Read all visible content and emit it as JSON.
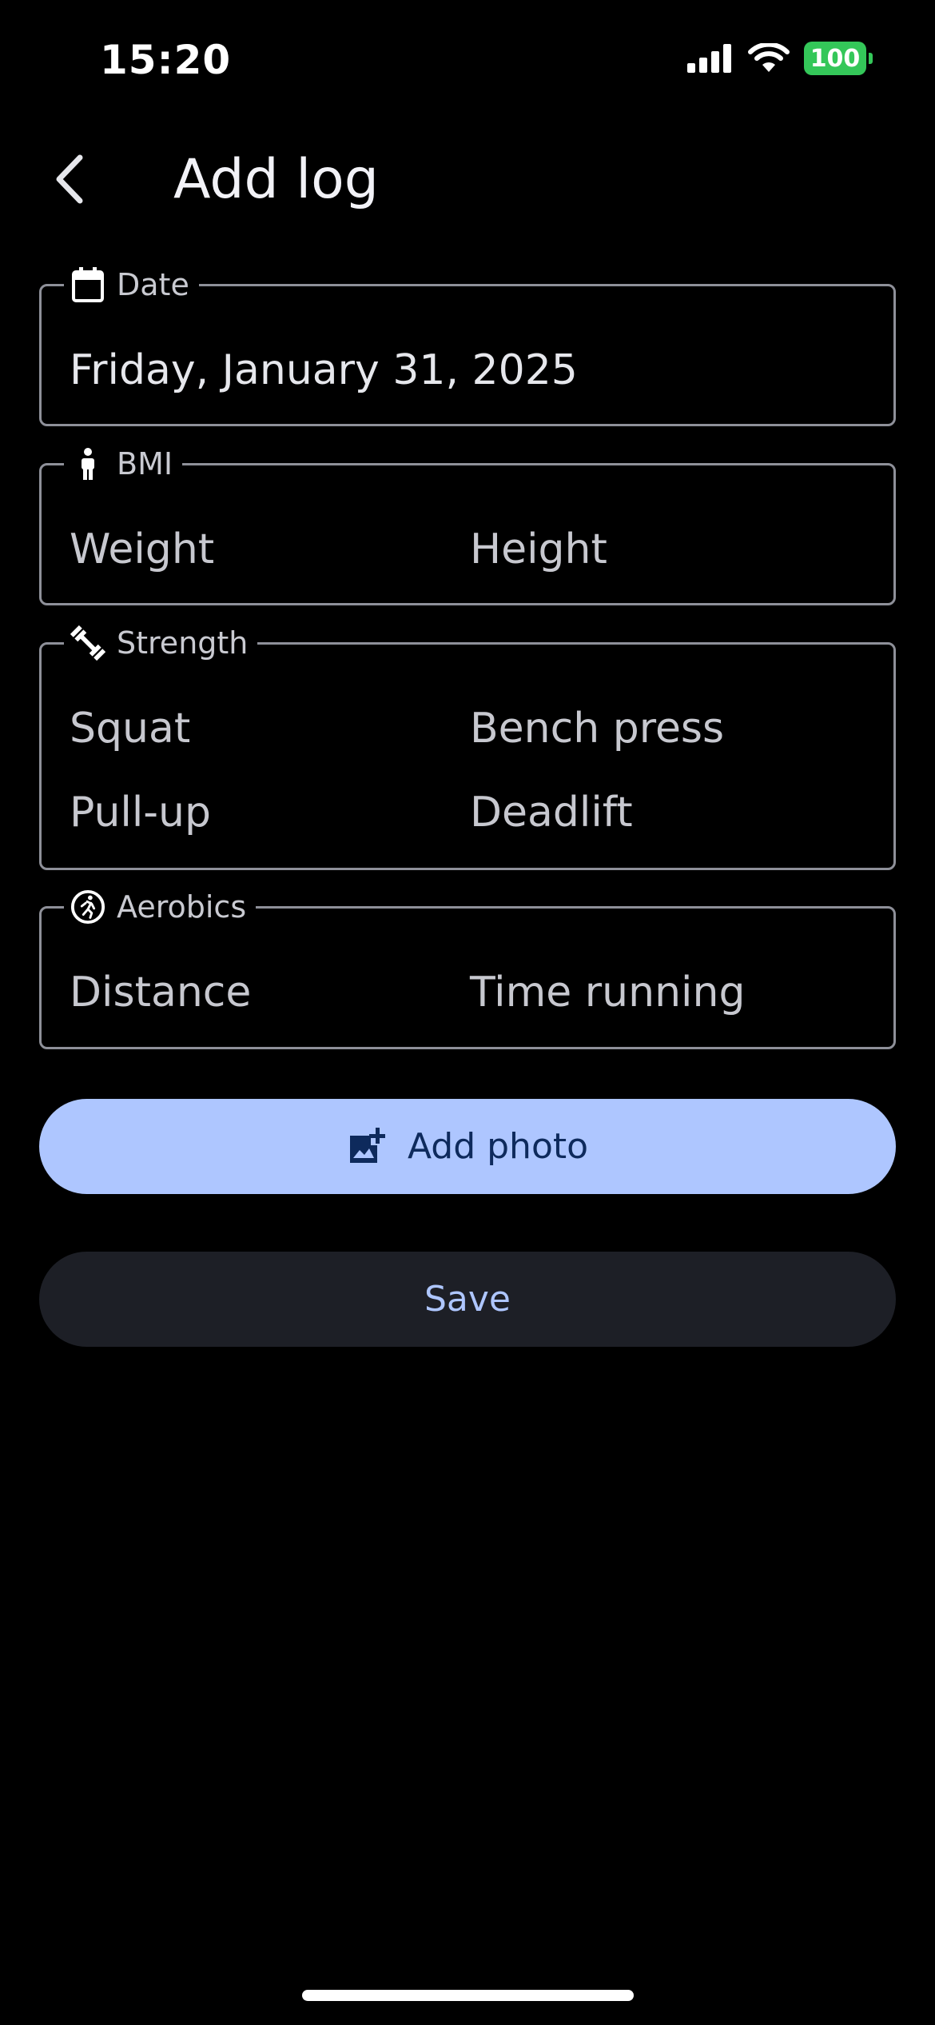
{
  "status_bar": {
    "time": "15:20",
    "battery": "100"
  },
  "header": {
    "title": "Add log"
  },
  "date_group": {
    "legend": "Date",
    "value": "Friday, January 31, 2025"
  },
  "bmi_group": {
    "legend": "BMI",
    "weight": "Weight",
    "height": "Height"
  },
  "strength_group": {
    "legend": "Strength",
    "squat": "Squat",
    "bench_press": "Bench press",
    "pull_up": "Pull-up",
    "deadlift": "Deadlift"
  },
  "aerobics_group": {
    "legend": "Aerobics",
    "distance": "Distance",
    "time_running": "Time running"
  },
  "actions": {
    "add_photo_label": "Add photo",
    "save_label": "Save"
  },
  "colors": {
    "background": "#000000",
    "primary_container": "#aec6ff",
    "on_primary_container": "#0e2a5c",
    "surface_button": "#1d1f26",
    "outline": "#8e9099",
    "battery": "#34c759"
  }
}
